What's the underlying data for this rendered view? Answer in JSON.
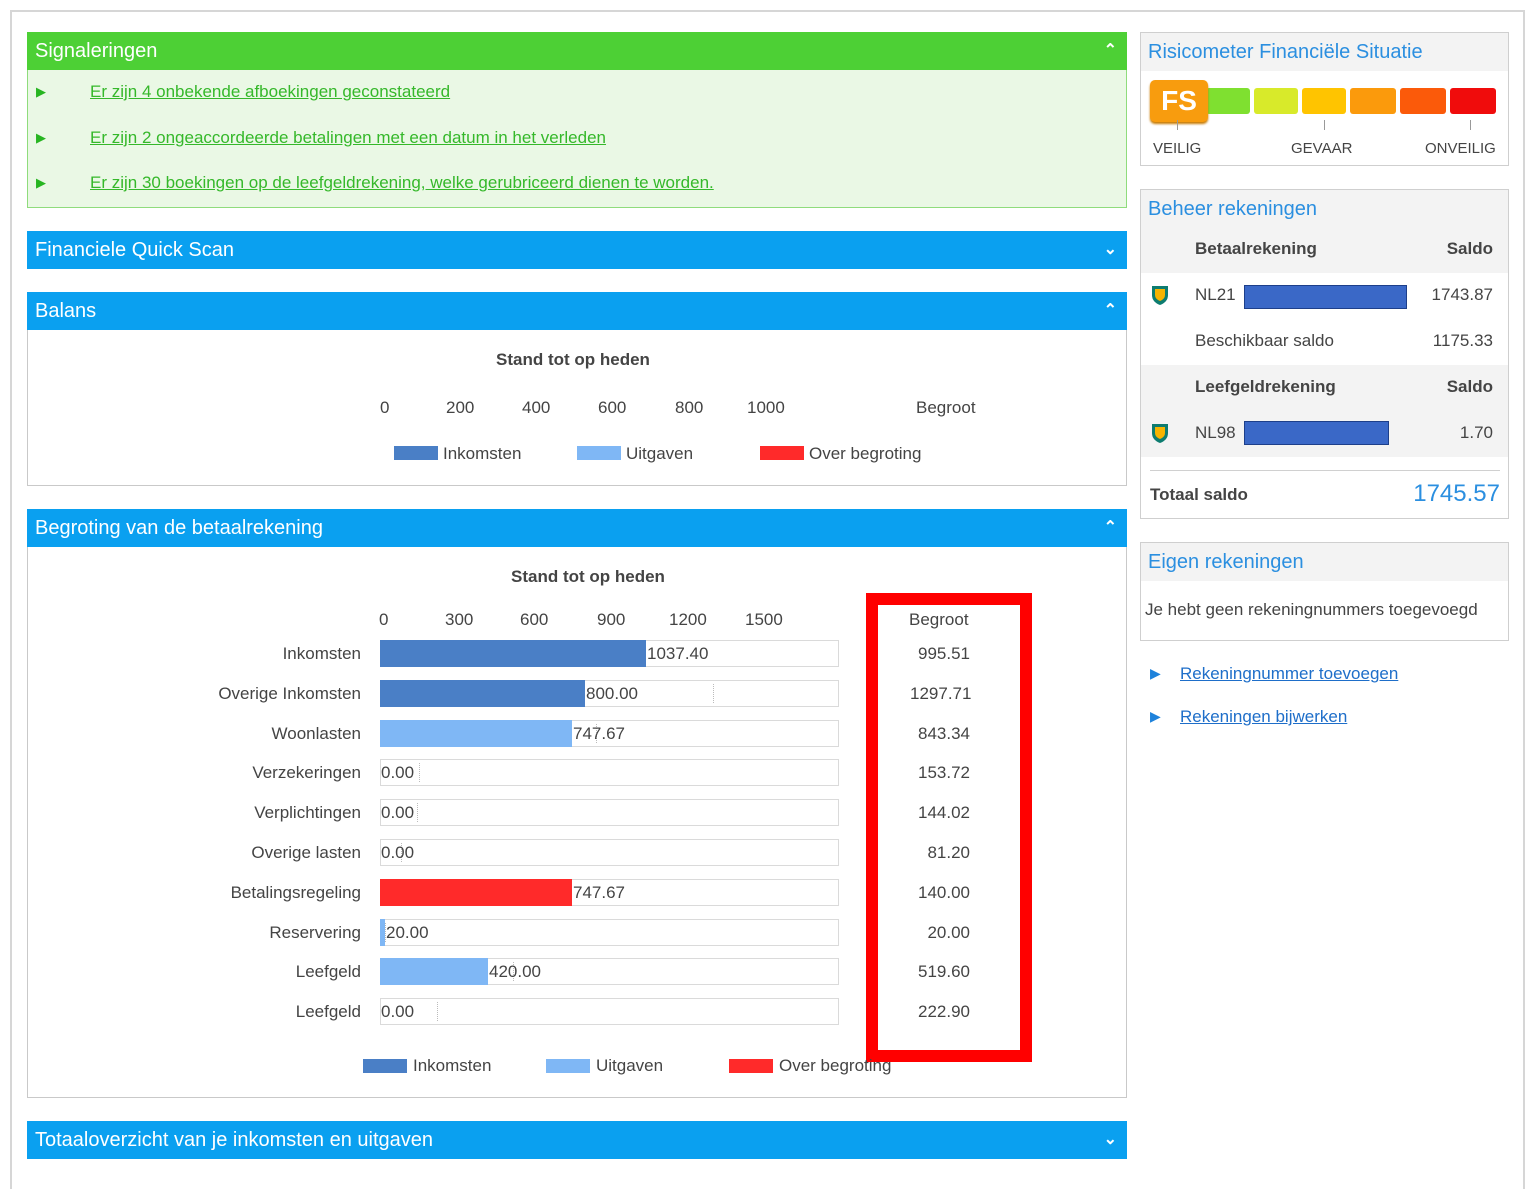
{
  "signaleringen": {
    "title": "Signaleringen",
    "items": [
      "Er zijn 4 onbekende afboekingen geconstateerd",
      "Er zijn 2 ongeaccordeerde betalingen met een datum in het verleden",
      "Er zijn 30 boekingen op de leefgeldrekening, welke gerubriceerd dienen te worden."
    ]
  },
  "quickscan": {
    "title": "Financiele Quick Scan"
  },
  "balans": {
    "title": "Balans",
    "chart_title": "Stand tot op heden",
    "ticks": [
      "0",
      "200",
      "400",
      "600",
      "800",
      "1000"
    ],
    "budget_header": "Begroot",
    "legend": [
      "Inkomsten",
      "Uitgaven",
      "Over begroting"
    ]
  },
  "begroting": {
    "title": "Begroting van de betaalrekening",
    "chart_title": "Stand tot op heden",
    "ticks": [
      "0",
      "300",
      "600",
      "900",
      "1200",
      "1500"
    ],
    "budget_header": "Begroot",
    "legend": [
      "Inkomsten",
      "Uitgaven",
      "Over begroting"
    ],
    "rows": [
      {
        "label": "Inkomsten",
        "value": "1037.40",
        "budget": "995.51"
      },
      {
        "label": "Overige Inkomsten",
        "value": "800.00",
        "budget": "1297.71"
      },
      {
        "label": "Woonlasten",
        "value": "747.67",
        "budget": "843.34"
      },
      {
        "label": "Verzekeringen",
        "value": "0.00",
        "budget": "153.72"
      },
      {
        "label": "Verplichtingen",
        "value": "0.00",
        "budget": "144.02"
      },
      {
        "label": "Overige lasten",
        "value": "0.00",
        "budget": "81.20"
      },
      {
        "label": "Betalingsregeling",
        "value": "747.67",
        "budget": "140.00"
      },
      {
        "label": "Reservering",
        "value": "20.00",
        "budget": "20.00"
      },
      {
        "label": "Leefgeld",
        "value": "420.00",
        "budget": "519.60"
      },
      {
        "label": "Leefgeld",
        "value": "0.00",
        "budget": "222.90"
      }
    ]
  },
  "chart_data": {
    "type": "bar",
    "title": "Stand tot op heden",
    "xlim": [
      0,
      1800
    ],
    "ticks": [
      0,
      300,
      600,
      900,
      1200,
      1500
    ],
    "categories": [
      "Inkomsten",
      "Overige Inkomsten",
      "Woonlasten",
      "Verzekeringen",
      "Verplichtingen",
      "Overige lasten",
      "Betalingsregeling",
      "Reservering",
      "Leefgeld",
      "Leefgeld"
    ],
    "values": [
      1037.4,
      800.0,
      747.67,
      0.0,
      0.0,
      0.0,
      747.67,
      20.0,
      420.0,
      0.0
    ],
    "budget": [
      995.51,
      1297.71,
      843.34,
      153.72,
      144.02,
      81.2,
      140.0,
      20.0,
      519.6,
      222.9
    ],
    "bar_kind": [
      "inkomsten",
      "inkomsten",
      "uitgaven",
      "uitgaven",
      "uitgaven",
      "uitgaven",
      "over",
      "uitgaven",
      "uitgaven",
      "uitgaven"
    ],
    "legend": [
      "Inkomsten",
      "Uitgaven",
      "Over begroting"
    ],
    "colors": {
      "inkomsten": "#4a7fc6",
      "uitgaven": "#7fb7f5",
      "over": "#ff2a2a"
    }
  },
  "totaaloverzicht": {
    "title": "Totaaloverzicht van je inkomsten en uitgaven"
  },
  "risicometer": {
    "title": "Risicometer Financiële Situatie",
    "badge": "FS",
    "labels": [
      "VEILIG",
      "GEVAAR",
      "ONVEILIG"
    ],
    "colors": [
      "#f89c0e",
      "#7fe030",
      "#d8ea2a",
      "#ffc400",
      "#fb9a0c",
      "#fb5a0a",
      "#f00c0c"
    ]
  },
  "beheer": {
    "title": "Beheer rekeningen",
    "betaal_header": "Betaalrekening",
    "saldo_header": "Saldo",
    "betaal_iban": "NL21",
    "betaal_saldo": "1743.87",
    "beschikbaar_label": "Beschikbaar saldo",
    "beschikbaar_value": "1175.33",
    "leef_header": "Leefgeldrekening",
    "saldo_header2": "Saldo",
    "leef_iban": "NL98",
    "leef_saldo": "1.70",
    "totaal_label": "Totaal saldo",
    "totaal_value": "1745.57"
  },
  "eigen": {
    "title": "Eigen rekeningen",
    "text": "Je hebt geen rekeningnummers toegevoegd"
  },
  "links": [
    "Rekeningnummer toevoegen",
    "Rekeningen bijwerken"
  ]
}
